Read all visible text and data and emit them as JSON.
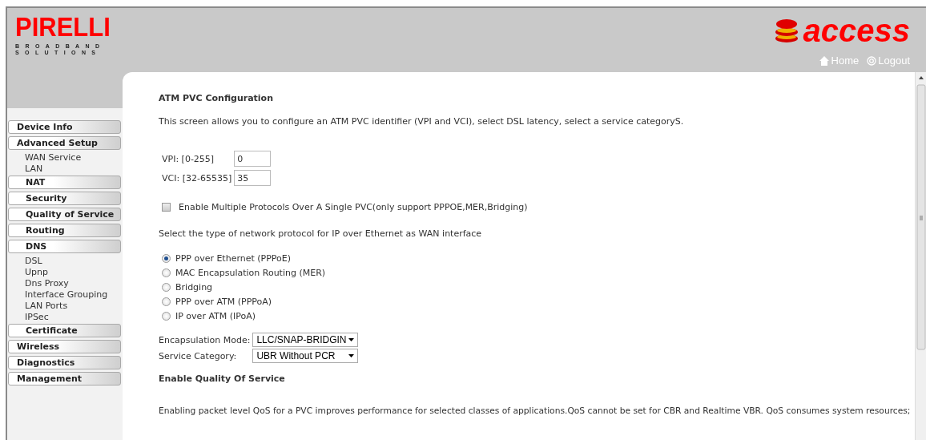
{
  "header": {
    "brand": "PIRELLI",
    "tagline_1": "BROADBAND",
    "tagline_2": "SOLUTIONS",
    "product": "access",
    "links": [
      {
        "label": "Home",
        "kind": "home"
      },
      {
        "label": "Logout",
        "kind": "logout"
      }
    ]
  },
  "sidebar": {
    "items": [
      {
        "label": "Device Info",
        "kind": "section"
      },
      {
        "label": "Advanced Setup",
        "kind": "section"
      },
      {
        "label": "WAN Service",
        "kind": "link"
      },
      {
        "label": "LAN",
        "kind": "link"
      },
      {
        "label": "NAT",
        "kind": "subsection"
      },
      {
        "label": "Security",
        "kind": "subsection"
      },
      {
        "label": "Quality of Service",
        "kind": "subsection"
      },
      {
        "label": "Routing",
        "kind": "subsection"
      },
      {
        "label": "DNS",
        "kind": "subsection"
      },
      {
        "label": "DSL",
        "kind": "link"
      },
      {
        "label": "Upnp",
        "kind": "link"
      },
      {
        "label": "Dns Proxy",
        "kind": "link"
      },
      {
        "label": "Interface Grouping",
        "kind": "link"
      },
      {
        "label": "LAN Ports",
        "kind": "link"
      },
      {
        "label": "IPSec",
        "kind": "link"
      },
      {
        "label": "Certificate",
        "kind": "subsection"
      },
      {
        "label": "Wireless",
        "kind": "section"
      },
      {
        "label": "Diagnostics",
        "kind": "section"
      },
      {
        "label": "Management",
        "kind": "section"
      }
    ]
  },
  "content": {
    "title": "ATM PVC Configuration",
    "description": "This screen allows you to configure an ATM PVC identifier (VPI and VCI), select DSL latency, select a service categoryS.",
    "fields": [
      {
        "label": "VPI: [0-255]",
        "value": "0"
      },
      {
        "label": "VCI: [32-65535]",
        "value": "35"
      }
    ],
    "multi_protocol": {
      "label": "Enable Multiple Protocols Over A Single PVC(only support PPPOE,MER,Bridging)",
      "checked": false
    },
    "protocol_prompt": "Select the type of network protocol for IP over Ethernet as WAN interface",
    "protocols": [
      {
        "label": "PPP over Ethernet (PPPoE)",
        "selected": true
      },
      {
        "label": "MAC Encapsulation Routing (MER)",
        "selected": false
      },
      {
        "label": "Bridging",
        "selected": false
      },
      {
        "label": "PPP over ATM (PPPoA)",
        "selected": false
      },
      {
        "label": "IP over ATM (IPoA)",
        "selected": false
      }
    ],
    "selects": [
      {
        "label": "Encapsulation Mode:",
        "value": "LLC/SNAP-BRIDGIN"
      },
      {
        "label": "Service Category:",
        "value": "UBR Without PCR"
      }
    ],
    "qos_title": "Enable Quality Of Service",
    "qos_text": "Enabling packet level QoS for a PVC improves performance for selected classes of applications.QoS cannot be set for CBR and Realtime VBR. QoS consumes system resources;"
  }
}
